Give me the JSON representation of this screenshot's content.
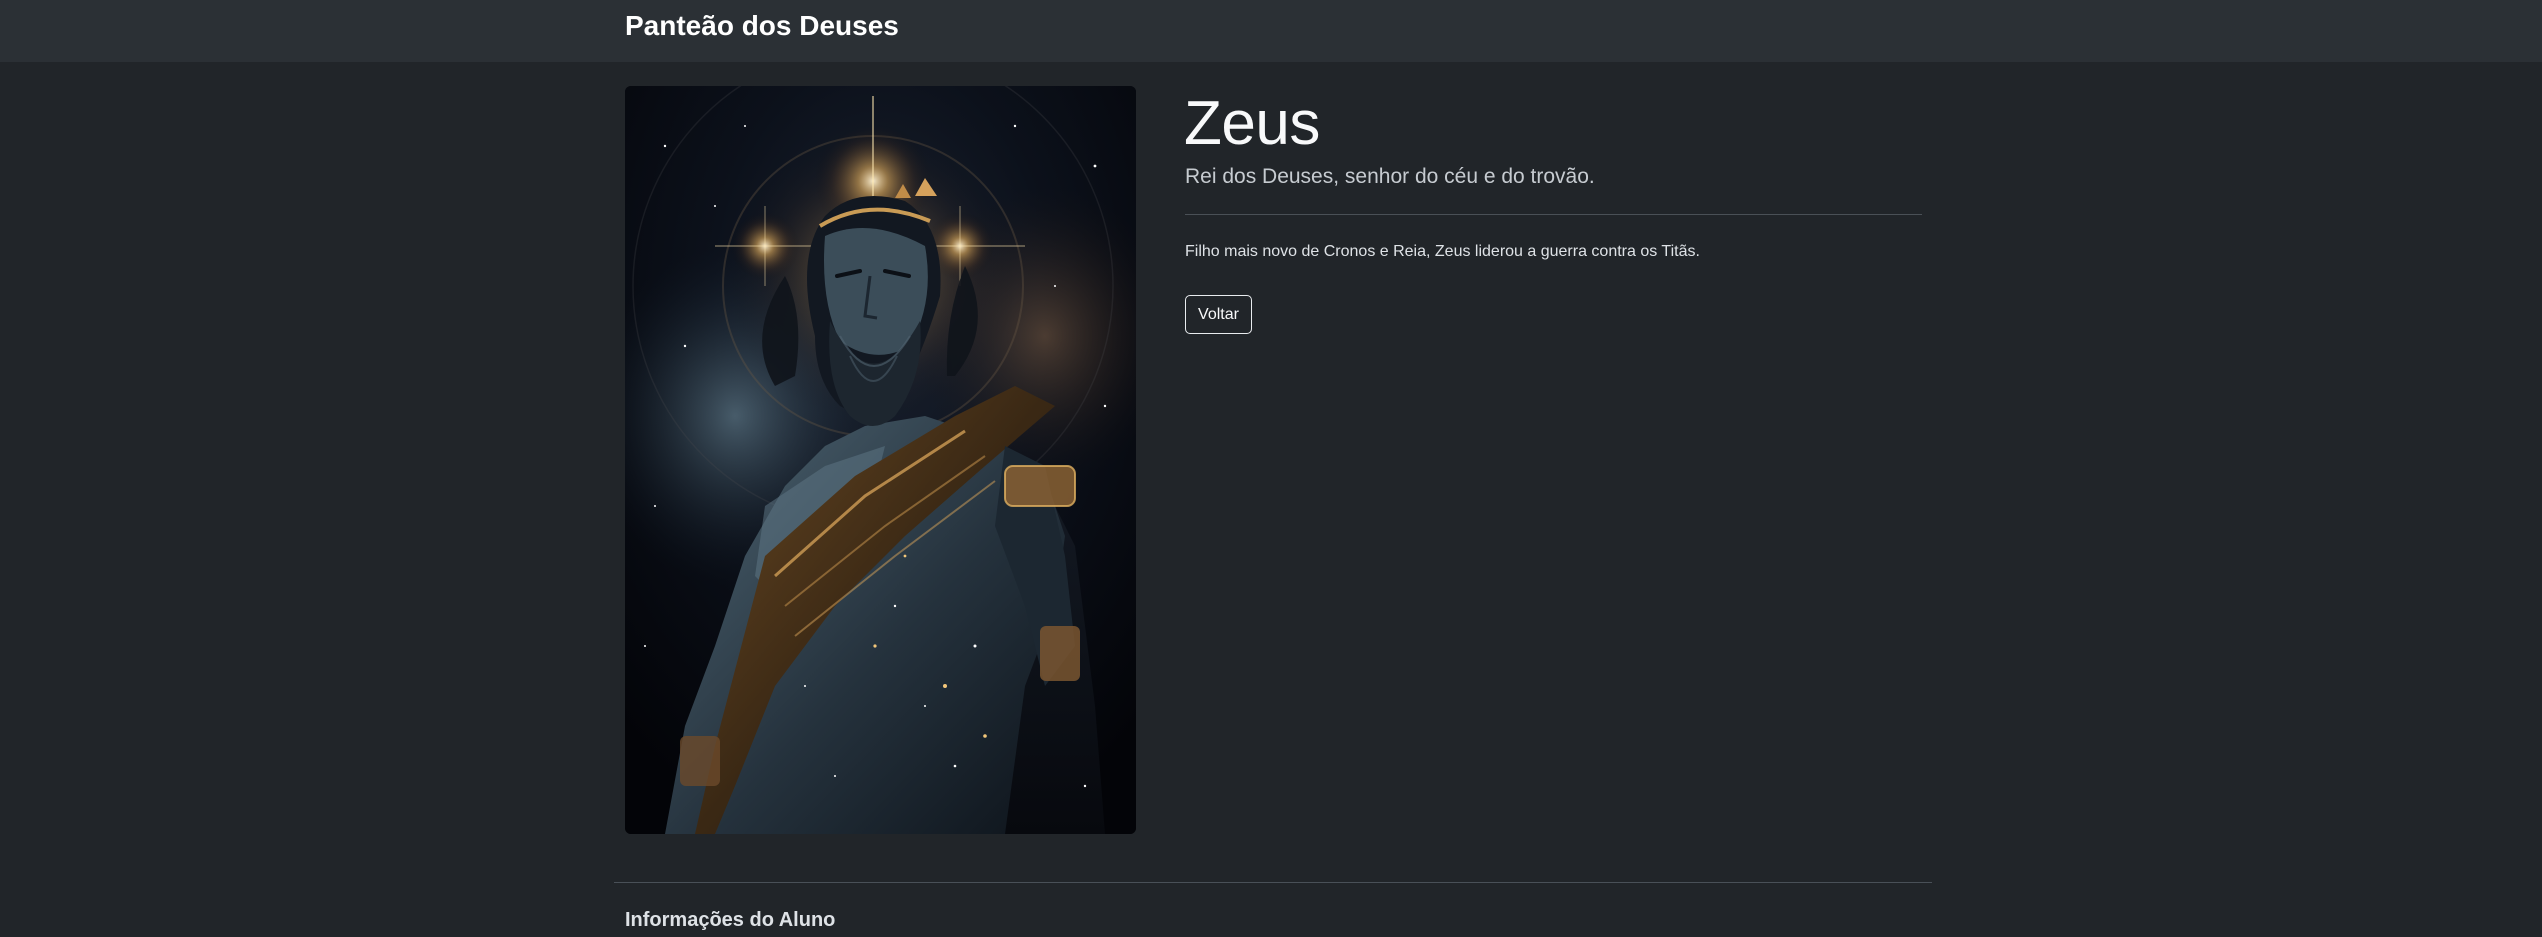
{
  "navbar": {
    "brand": "Panteão dos Deuses"
  },
  "god": {
    "name": "Zeus",
    "title": "Rei dos Deuses, senhor do céu e do trovão.",
    "description": "Filho mais novo de Cronos e Reia, Zeus liderou a guerra contra os Titãs.",
    "image_alt": "Zeus"
  },
  "actions": {
    "back_label": "Voltar"
  },
  "footer": {
    "heading": "Informações do Aluno"
  },
  "colors": {
    "background": "#212529",
    "navbar": "#2b3035",
    "text": "#dee2e6",
    "accent_gold": "#e0b060"
  }
}
